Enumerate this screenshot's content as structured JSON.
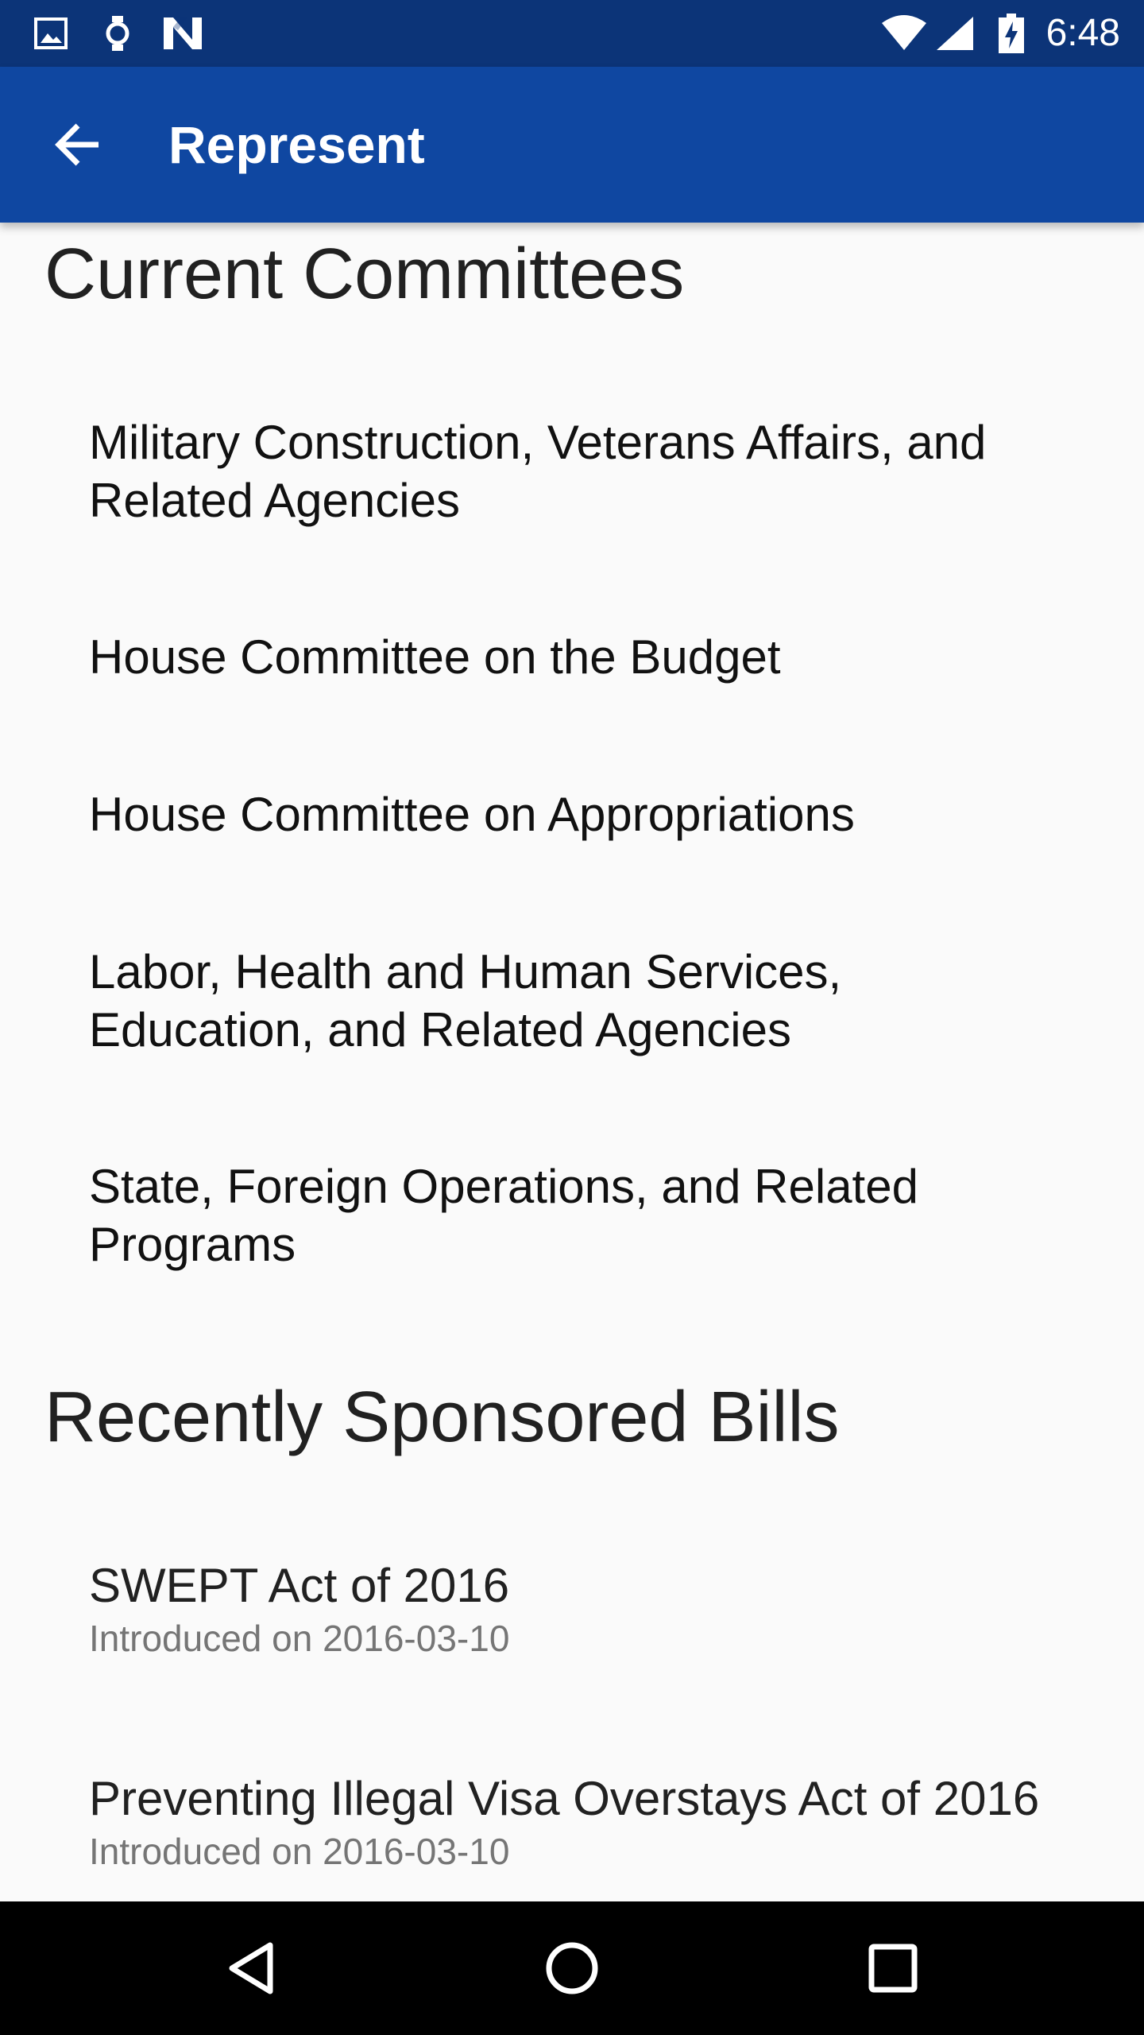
{
  "status_bar": {
    "time": "6:48",
    "left_icons": [
      "image-notification-icon",
      "watch-notification-icon",
      "n-notification-icon"
    ],
    "right_icons": [
      "wifi-icon",
      "signal-icon",
      "battery-charging-icon"
    ]
  },
  "app_bar": {
    "title": "Represent",
    "back_icon": "arrow-back-icon",
    "background": "#0f47a1"
  },
  "committees": {
    "heading": "Current Committees",
    "items": [
      "Military Construction, Veterans Affairs, and Related Agencies",
      "House Committee on the Budget",
      "House Committee on Appropriations",
      "Labor, Health and Human Services, Education, and Related Agencies",
      "State, Foreign Operations, and Related Programs"
    ]
  },
  "bills": {
    "heading": "Recently Sponsored Bills",
    "items": [
      {
        "title": "SWEPT Act of 2016",
        "date": "Introduced on 2016-03-10"
      },
      {
        "title": "Preventing Illegal Visa Overstays Act of 2016",
        "date": "Introduced on 2016-03-10"
      }
    ]
  },
  "nav_bar": {
    "buttons": [
      "back-nav-icon",
      "home-nav-icon",
      "recents-nav-icon"
    ]
  }
}
